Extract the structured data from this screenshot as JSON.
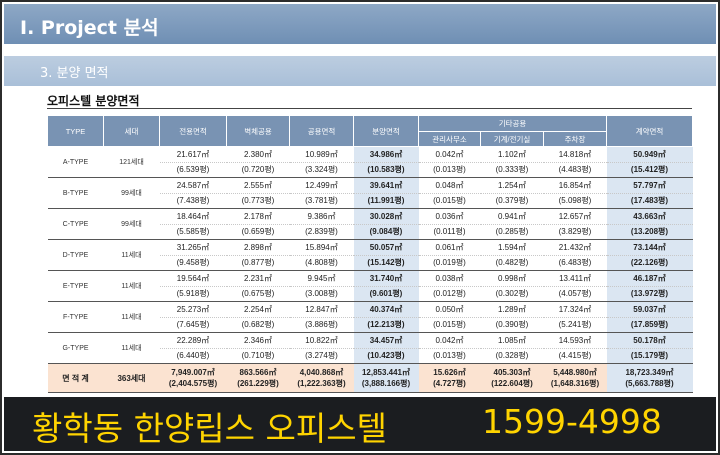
{
  "header": {
    "title": "I.  Project 분석",
    "section": "3.  분양 면적"
  },
  "table_title": "오피스텔 분양면적",
  "columns": {
    "type": "TYPE",
    "units": "세대",
    "exclusive": "전용면적",
    "wall_common": "벽체공용",
    "common": "공용면적",
    "sale": "분양면적",
    "other": "기타공용",
    "mgmt": "관리사무소",
    "machine": "기계/전기실",
    "parking": "주차장",
    "contract": "계약면적"
  },
  "rows": [
    {
      "type": "A-TYPE",
      "units": "121세대",
      "excl": [
        "21.617㎡",
        "(6.539평)"
      ],
      "wall": [
        "2.380㎡",
        "(0.720평)"
      ],
      "common": [
        "10.989㎡",
        "(3.324평)"
      ],
      "sale": [
        "34.986㎡",
        "(10.583평)"
      ],
      "mgmt": [
        "0.042㎡",
        "(0.013평)"
      ],
      "mach": [
        "1.102㎡",
        "(0.333평)"
      ],
      "park": [
        "14.818㎡",
        "(4.483평)"
      ],
      "contract": [
        "50.949㎡",
        "(15.412평)"
      ]
    },
    {
      "type": "B-TYPE",
      "units": "99세대",
      "excl": [
        "24.587㎡",
        "(7.438평)"
      ],
      "wall": [
        "2.555㎡",
        "(0.773평)"
      ],
      "common": [
        "12.499㎡",
        "(3.781평)"
      ],
      "sale": [
        "39.641㎡",
        "(11.991평)"
      ],
      "mgmt": [
        "0.048㎡",
        "(0.015평)"
      ],
      "mach": [
        "1.254㎡",
        "(0.379평)"
      ],
      "park": [
        "16.854㎡",
        "(5.098평)"
      ],
      "contract": [
        "57.797㎡",
        "(17.483평)"
      ]
    },
    {
      "type": "C-TYPE",
      "units": "99세대",
      "excl": [
        "18.464㎡",
        "(5.585평)"
      ],
      "wall": [
        "2.178㎡",
        "(0.659평)"
      ],
      "common": [
        "9.386㎡",
        "(2.839평)"
      ],
      "sale": [
        "30.028㎡",
        "(9.084평)"
      ],
      "mgmt": [
        "0.036㎡",
        "(0.011평)"
      ],
      "mach": [
        "0.941㎡",
        "(0.285평)"
      ],
      "park": [
        "12.657㎡",
        "(3.829평)"
      ],
      "contract": [
        "43.663㎡",
        "(13.208평)"
      ]
    },
    {
      "type": "D-TYPE",
      "units": "11세대",
      "excl": [
        "31.265㎡",
        "(9.458평)"
      ],
      "wall": [
        "2.898㎡",
        "(0.877평)"
      ],
      "common": [
        "15.894㎡",
        "(4.808평)"
      ],
      "sale": [
        "50.057㎡",
        "(15.142평)"
      ],
      "mgmt": [
        "0.061㎡",
        "(0.019평)"
      ],
      "mach": [
        "1.594㎡",
        "(0.482평)"
      ],
      "park": [
        "21.432㎡",
        "(6.483평)"
      ],
      "contract": [
        "73.144㎡",
        "(22.126평)"
      ]
    },
    {
      "type": "E-TYPE",
      "units": "11세대",
      "excl": [
        "19.564㎡",
        "(5.918평)"
      ],
      "wall": [
        "2.231㎡",
        "(0.675평)"
      ],
      "common": [
        "9.945㎡",
        "(3.008평)"
      ],
      "sale": [
        "31.740㎡",
        "(9.601평)"
      ],
      "mgmt": [
        "0.038㎡",
        "(0.012평)"
      ],
      "mach": [
        "0.998㎡",
        "(0.302평)"
      ],
      "park": [
        "13.411㎡",
        "(4.057평)"
      ],
      "contract": [
        "46.187㎡",
        "(13.972평)"
      ]
    },
    {
      "type": "F-TYPE",
      "units": "11세대",
      "excl": [
        "25.273㎡",
        "(7.645평)"
      ],
      "wall": [
        "2.254㎡",
        "(0.682평)"
      ],
      "common": [
        "12.847㎡",
        "(3.886평)"
      ],
      "sale": [
        "40.374㎡",
        "(12.213평)"
      ],
      "mgmt": [
        "0.050㎡",
        "(0.015평)"
      ],
      "mach": [
        "1.289㎡",
        "(0.390평)"
      ],
      "park": [
        "17.324㎡",
        "(5.241평)"
      ],
      "contract": [
        "59.037㎡",
        "(17.859평)"
      ]
    },
    {
      "type": "G-TYPE",
      "units": "11세대",
      "excl": [
        "22.289㎡",
        "(6.440평)"
      ],
      "wall": [
        "2.346㎡",
        "(0.710평)"
      ],
      "common": [
        "10.822㎡",
        "(3.274평)"
      ],
      "sale": [
        "34.457㎡",
        "(10.423평)"
      ],
      "mgmt": [
        "0.042㎡",
        "(0.013평)"
      ],
      "mach": [
        "1.085㎡",
        "(0.328평)"
      ],
      "park": [
        "14.593㎡",
        "(4.415평)"
      ],
      "contract": [
        "50.178㎡",
        "(15.179평)"
      ]
    }
  ],
  "total": {
    "label": "면 적 계",
    "units": "363세대",
    "excl": [
      "7,949.007㎡",
      "(2,404.575평)"
    ],
    "wall": [
      "863.566㎡",
      "(261.229평)"
    ],
    "common": [
      "4,040.868㎡",
      "(1,222.363평)"
    ],
    "sale": [
      "12,853.441㎡",
      "(3,888.166평)"
    ],
    "mgmt": [
      "15.626㎡",
      "(4.727평)"
    ],
    "mach": [
      "405.303㎡",
      "(122.604평)"
    ],
    "park": [
      "5,448.980㎡",
      "(1,648.316평)"
    ],
    "contract": [
      "18,723.349㎡",
      "(5,663.788평)"
    ]
  },
  "banner": {
    "name": "황학동 한양립스 오피스텔",
    "phone": "1599-4998"
  },
  "colors": {
    "header_bar": "#7993b3",
    "highlight": "#dbe6f2",
    "total_row": "#fbe3d1",
    "banner_text": "#ffd400",
    "banner_bg": "#1b1d20"
  }
}
